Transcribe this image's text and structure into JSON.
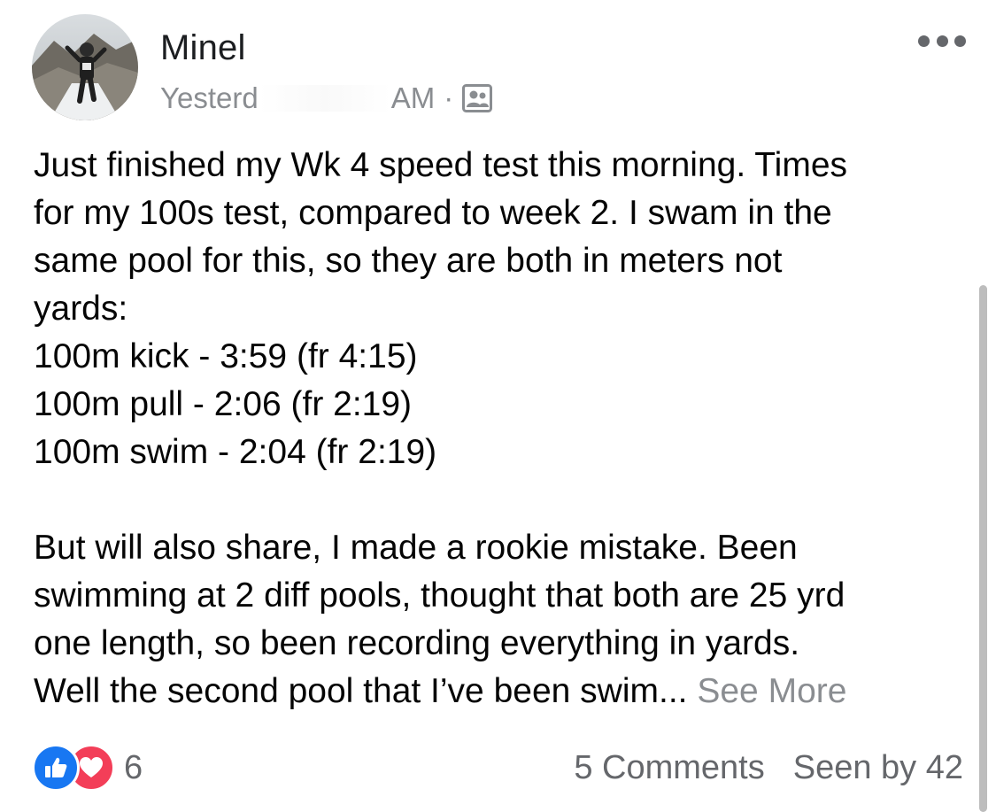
{
  "post": {
    "author_name": "Minel",
    "timestamp_prefix": "Yesterd",
    "timestamp_suffix": "AM",
    "separator": "·",
    "audience_icon": "friends-audience-icon",
    "more_icon": "more-options-icon",
    "body_lines": [
      "Just finished my Wk 4 speed test this morning. Times",
      "for my 100s test, compared to week 2.  I swam in the",
      "same pool for this, so they are both in meters not",
      "yards:",
      "100m kick - 3:59 (fr 4:15)",
      "100m pull - 2:06 (fr 2:19)",
      "100m swim - 2:04 (fr 2:19)"
    ],
    "body_lines_2": [
      "But will also share, I made a rookie mistake.  Been",
      "swimming at 2 diff pools, thought that both are 25 yrd",
      "one length, so been recording everything in yards."
    ],
    "truncated_line": "Well the second pool that I’ve been swim...",
    "see_more_label": "See More"
  },
  "footer": {
    "reaction_count": "6",
    "comments_label": "5 Comments",
    "seen_by_label": "Seen by 42"
  },
  "colors": {
    "like_blue": "#1877f2",
    "love_red": "#f33e58",
    "secondary_text": "#8a8d91"
  }
}
